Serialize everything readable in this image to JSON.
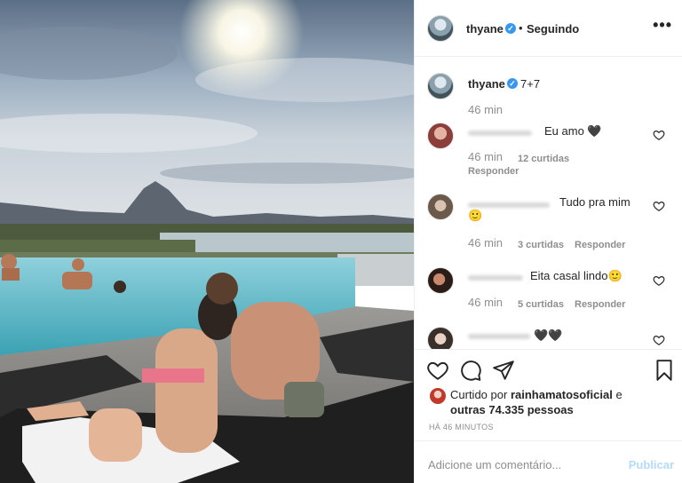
{
  "post": {
    "author": "thyane",
    "follow_status": "Seguindo",
    "separator": "•",
    "more_glyph": "•••",
    "verified_glyph": "✓"
  },
  "caption": {
    "author": "thyane",
    "text": "7+7",
    "time": "46 min"
  },
  "comments": [
    {
      "text": "Eu amo 🖤",
      "time": "46 min",
      "likes": "12 curtidas",
      "reply": "Responder"
    },
    {
      "text_line1": "Tudo pra mim",
      "text_line2": "🙂",
      "time": "46 min",
      "likes": "3 curtidas",
      "reply": "Responder"
    },
    {
      "text": "Eita casal lindo🙂",
      "time": "46 min",
      "likes": "5 curtidas",
      "reply": "Responder"
    },
    {
      "text": "🖤🖤"
    }
  ],
  "likes_summary": {
    "prefix": "Curtido por",
    "user": "rainhamatosoficial",
    "joiner": "e",
    "others": "outras 74.335 pessoas"
  },
  "timestamp": "HÁ 46 MINUTOS",
  "comment_box": {
    "placeholder": "Adicione um comentário...",
    "publish": "Publicar"
  },
  "icons": [
    "heart-icon",
    "comment-icon",
    "share-icon",
    "bookmark-icon",
    "more-options-icon",
    "verified-icon"
  ],
  "colors": {
    "verified": "#3897f0",
    "publish_disabled": "#b3dbff",
    "meta_gray": "#8e8e8e"
  }
}
